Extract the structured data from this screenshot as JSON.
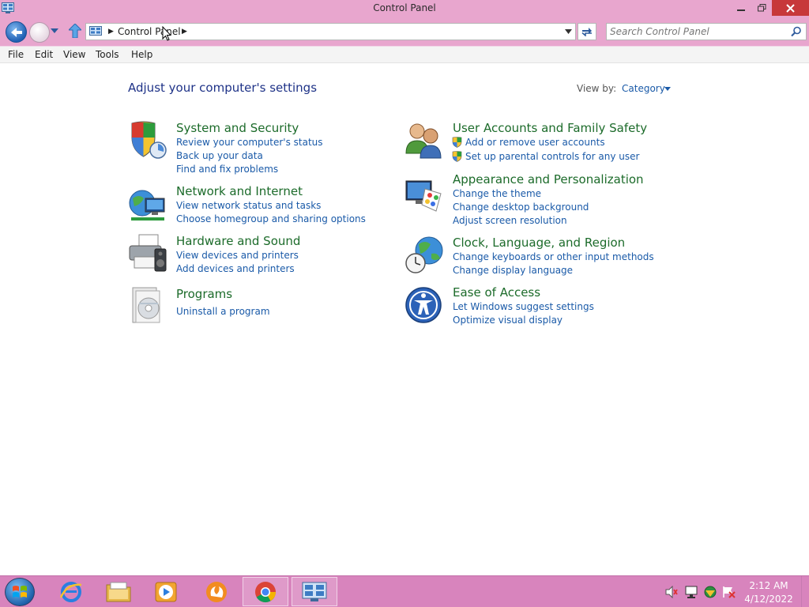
{
  "window": {
    "title": "Control Panel"
  },
  "address_bar": {
    "crumb": "Control Panel"
  },
  "search": {
    "placeholder": "Search Control Panel"
  },
  "menu": {
    "items": [
      "File",
      "Edit",
      "View",
      "Tools",
      "Help"
    ]
  },
  "content": {
    "heading": "Adjust your computer's settings",
    "view_by_label": "View by:",
    "view_by_value": "Category",
    "categories": [
      {
        "title": "System and Security",
        "icon": "shield-icon",
        "links": [
          "Review your computer's status",
          "Back up your data",
          "Find and fix problems"
        ]
      },
      {
        "title": "Network and Internet",
        "icon": "globe-network-icon",
        "links": [
          "View network status and tasks",
          "Choose homegroup and sharing options"
        ]
      },
      {
        "title": "Hardware and Sound",
        "icon": "printer-speaker-icon",
        "links": [
          "View devices and printers",
          "Add devices and printers"
        ]
      },
      {
        "title": "Programs",
        "icon": "programs-icon",
        "links": [
          "Uninstall a program"
        ]
      },
      {
        "title": "User Accounts and Family Safety",
        "icon": "users-icon",
        "links": [
          "Add or remove user accounts",
          "Set up parental controls for any user"
        ]
      },
      {
        "title": "Appearance and Personalization",
        "icon": "monitor-palette-icon",
        "links": [
          "Change the theme",
          "Change desktop background",
          "Adjust screen resolution"
        ]
      },
      {
        "title": "Clock, Language, and Region",
        "icon": "clock-globe-icon",
        "links": [
          "Change keyboards or other input methods",
          "Change display language"
        ]
      },
      {
        "title": "Ease of Access",
        "icon": "ease-of-access-icon",
        "links": [
          "Let Windows suggest settings",
          "Optimize visual display"
        ]
      }
    ]
  },
  "taskbar": {
    "apps": [
      "internet-explorer-icon",
      "file-explorer-icon",
      "media-player-icon",
      "uc-browser-icon",
      "chrome-icon",
      "control-panel-icon"
    ],
    "tray": [
      "volume-muted-icon",
      "network-icon",
      "action-center-icon",
      "flag-icon"
    ],
    "time": "2:12 AM",
    "date": "4/12/2022"
  },
  "colors": {
    "titlebar": "#e8a6ce",
    "taskbar": "#d884bd",
    "category_title": "#1c6b2a",
    "link": "#1a5aa8",
    "heading": "#1e3287"
  }
}
